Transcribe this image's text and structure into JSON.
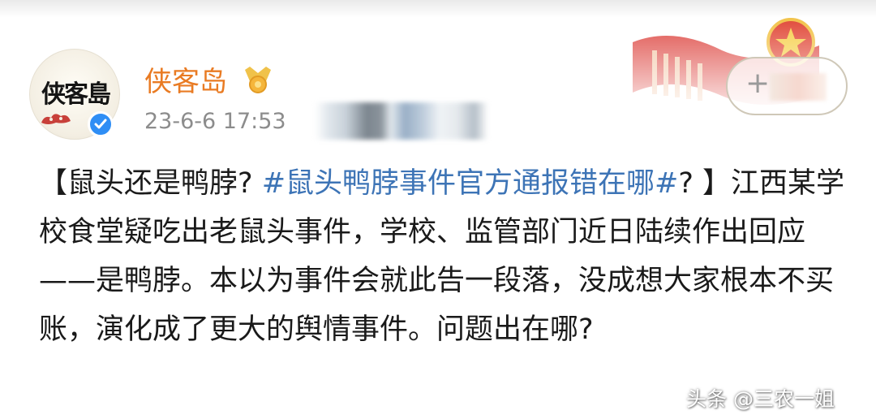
{
  "post": {
    "author": {
      "name": "侠客岛",
      "avatar_text": "侠客島",
      "verified": true
    },
    "timestamp": "23-6-6 17:53",
    "follow_button": {
      "icon": "plus-icon",
      "label_obscured": true
    },
    "content": {
      "open_bracket": "【鼠头还是鸭脖? ",
      "hashtag": "#鼠头鸭脖事件官方通报错在哪#",
      "after_hashtag": "? 】江西某学校食堂疑吃出老鼠头事件，学校、监管部门近日陆续作出回应——是鸭脖。本以为事件会就此告一段落，没成想大家根本不买账，演化成了更大的舆情事件。问题出在哪?"
    }
  },
  "watermark": "头条 @三农一姐",
  "colors": {
    "author_name": "#e97b23",
    "hashtag": "#3d74b6",
    "timestamp": "#8c8c8c",
    "verified_badge": "#2f8ef5"
  }
}
